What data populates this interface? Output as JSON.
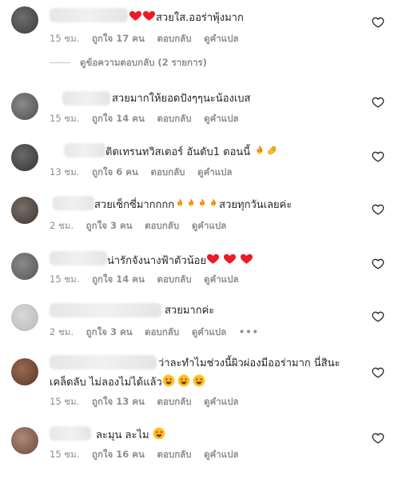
{
  "colors": {
    "text": "#262626",
    "meta": "#8e8e8e",
    "heart_red": "#ed1b24",
    "fire_orange": "#f77f00",
    "emoji_yellow": "#fcc21b"
  },
  "meta_labels": {
    "reply": "ตอบกลับ",
    "translate": "ดูคำแปล",
    "more": "•••"
  },
  "view_replies": "ดูข้อความตอบกลับ (2 รายการ)",
  "comments": [
    {
      "text": "สวยใส.ออร่าพุ้งมาก",
      "emoji_before": [
        "heart",
        "heart"
      ],
      "emoji_after": [],
      "time": "15 ชม.",
      "likes": "ถูกใจ 17 คน"
    },
    {
      "text": "สวยมากให้ยอดปังๆๆนะน้องเบส",
      "emoji_before": [],
      "emoji_after": [],
      "time": "15 ชม.",
      "likes": "ถูกใจ 14 คน"
    },
    {
      "text": "ติดเทรนทวิสเตอร์ อันดับ1 ตอนนี้",
      "emoji_before": [],
      "emoji_after": [
        "fire",
        "clap"
      ],
      "time": "13 ชม.",
      "likes": "ถูกใจ 6 คน"
    },
    {
      "text_a": "สวยเซ็กซี่มากกกก",
      "text_b": "สวยทุกวันเลยค่ะ",
      "emoji_mid": [
        "fire",
        "fire",
        "fire",
        "fire"
      ],
      "time": "2 ชม.",
      "likes": "ถูกใจ 3 คน"
    },
    {
      "text": "น่ารักจังนางฟ้าตัวน้อย",
      "emoji_before": [],
      "emoji_after": [
        "heart",
        "heart",
        "heart"
      ],
      "time": "15 ชม.",
      "likes": "ถูกใจ 14 คน"
    },
    {
      "text": "สวยมากค่ะ",
      "emoji_before": [],
      "emoji_after": [],
      "time": "2 ชม.",
      "likes": "ถูกใจ 3 คน",
      "show_more": true
    },
    {
      "text_line1": "ว่าละทำไมช่วงนี้ผิวผ่องมีออร่ามาก นี่สินะ",
      "text_line2": "เคล็ดลับ ไม่ลองไม่ได้แล้ว",
      "emoji_after": [
        "starstruck",
        "starstruck",
        "starstruck"
      ],
      "time": "15 ชม.",
      "likes": "ถูกใจ 13 คน"
    },
    {
      "text": "ละมุน ละไม",
      "emoji_before": [],
      "emoji_after": [
        "starstruck"
      ],
      "time": "15 ชม.",
      "likes": "ถูกใจ 16 คน"
    }
  ]
}
